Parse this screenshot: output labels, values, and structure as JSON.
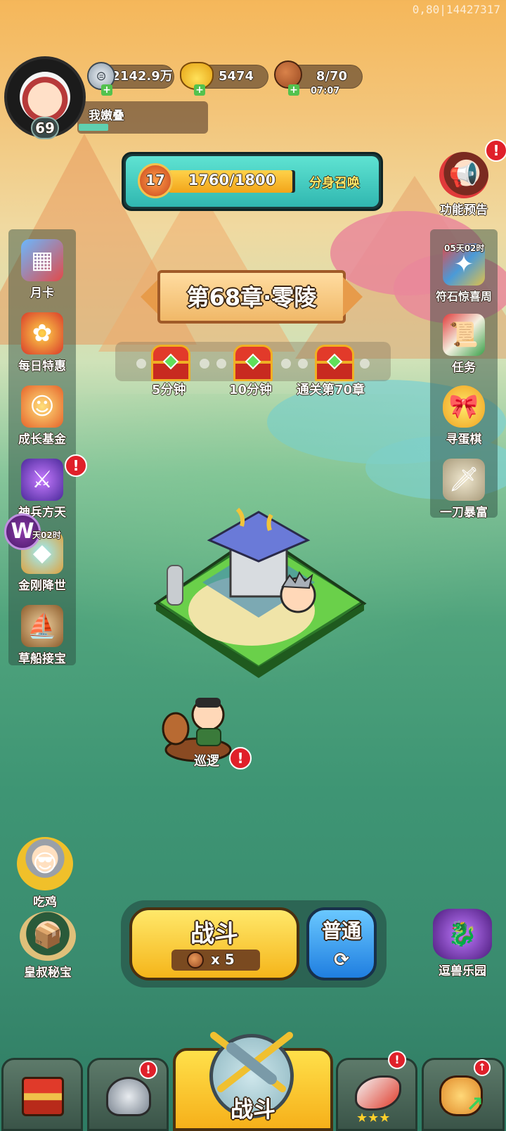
{
  "overlay": {
    "debug_text": "0,80|14427317"
  },
  "player": {
    "name": "我嫩叠",
    "level": "69"
  },
  "resources": {
    "silver": "2142.9万",
    "gold": "5474",
    "stamina": "8/70",
    "stamina_timer": "07:07"
  },
  "summon": {
    "level": "17",
    "progress_text": "1760/1800",
    "progress": 0.978,
    "label": "分身召唤"
  },
  "chapter": {
    "title": "第68章·零陵"
  },
  "rewards": [
    {
      "label": "5分钟"
    },
    {
      "label": "10分钟"
    },
    {
      "label": "通关第70章"
    }
  ],
  "left_menu": [
    {
      "label": "月卡",
      "icon": "calendar-icon"
    },
    {
      "label": "每日特惠",
      "icon": "gift-bag-icon"
    },
    {
      "label": "成长基金",
      "icon": "fund-icon"
    },
    {
      "label": "神兵方天",
      "icon": "weapon-icon",
      "alert": "!"
    },
    {
      "label": "金刚降世",
      "icon": "treasure-icon",
      "timer": "天02时"
    },
    {
      "label": "草船接宝",
      "icon": "boat-icon"
    }
  ],
  "right_menu": [
    {
      "label": "功能预告",
      "icon": "announcer-icon",
      "alert": "!"
    },
    {
      "label": "符石惊喜周",
      "icon": "rune-stone-icon",
      "timer": "05天02时"
    },
    {
      "label": "任务",
      "icon": "scroll-icon"
    },
    {
      "label": "寻蛋棋",
      "icon": "egg-icon"
    },
    {
      "label": "一刀暴富",
      "icon": "sword-stone-icon"
    }
  ],
  "patrol": {
    "label": "巡逻",
    "alert": "!"
  },
  "bottom_left": [
    {
      "label": "吃鸡"
    },
    {
      "label": "皇叔秘宝"
    }
  ],
  "bottom_right": {
    "label": "逗兽乐园"
  },
  "battle": {
    "label": "战斗",
    "cost": "x 5",
    "mode": "普通"
  },
  "nav": {
    "center_label": "战斗"
  },
  "colors": {
    "alert": "#e0202a",
    "battle_yellow": "#f5b51a",
    "mode_blue": "#1f7ee0",
    "teal_banner": "#30b7b0"
  }
}
